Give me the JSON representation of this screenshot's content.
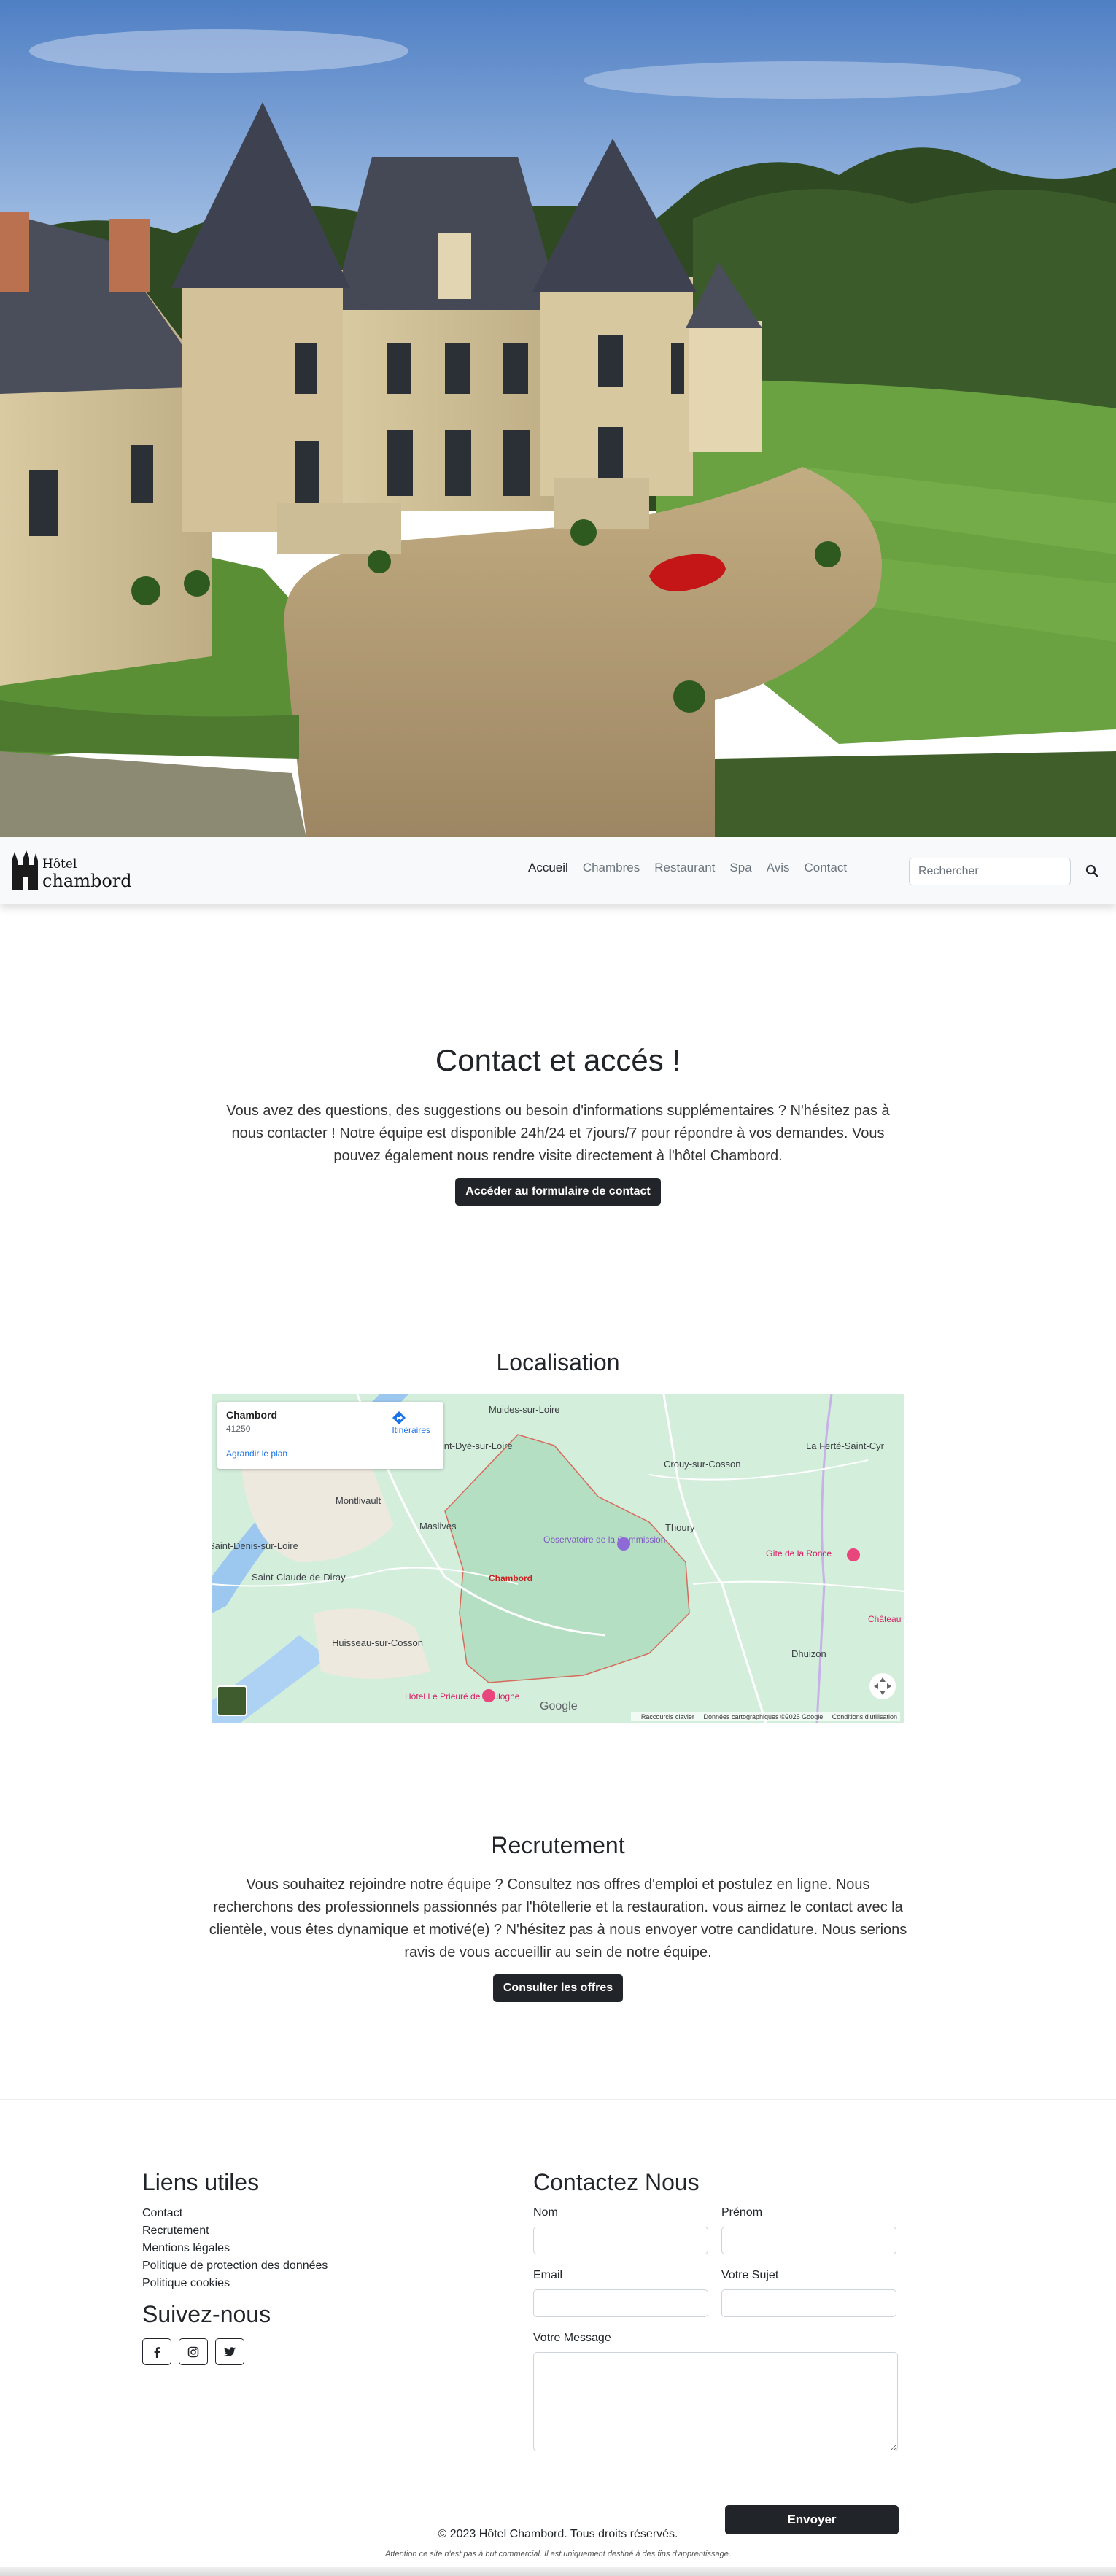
{
  "hero": {
    "image": "chateau-hotel-aerial-photo"
  },
  "navbar": {
    "brand_small": "Hôtel",
    "brand_big": "chambord",
    "links": [
      "Accueil",
      "Chambres",
      "Restaurant",
      "Spa",
      "Avis",
      "Contact"
    ],
    "active": "Accueil",
    "search_placeholder": "Rechercher",
    "search_icon": "search-icon"
  },
  "contact": {
    "title": "Contact et accés !",
    "text": "Vous avez des questions, des suggestions ou besoin d'informations supplémentaires ? N'hésitez pas à nous contacter ! Notre équipe est disponible 24h/24 et 7jours/7 pour répondre à vos demandes. Vous pouvez également nous rendre visite directement à l'hôtel Chambord.",
    "button": "Accéder au formulaire de contact"
  },
  "localisation": {
    "title": "Localisation",
    "map": {
      "place_name": "Chambord",
      "place_zip": "41250",
      "directions": "Itinéraires",
      "enlarge": "Agrandir le plan",
      "labels": [
        "Muides-sur-Loire",
        "Saint-Dyé-sur-Loire",
        "Montlivault",
        "Maslives",
        "Saint-Claude-de-Diray",
        "Huisseau-sur-Cosson",
        "Chambord",
        "Observatoire de la Commission",
        "Crouy-sur-Cosson",
        "Thoury",
        "La Ferté-Saint-Cyr",
        "Gîte de la Ronce",
        "Dhuizon",
        "Hôtel Le Prieuré de Boulogne",
        "Saint-Denis-sur-Loire",
        "Château de Chambord"
      ],
      "attribution_google": "Google",
      "footer": [
        "Raccourcis clavier",
        "Données cartographiques ©2025 Google",
        "Conditions d'utilisation"
      ]
    }
  },
  "recrutement": {
    "title": "Recrutement",
    "text": "Vous souhaitez rejoindre notre équipe ? Consultez nos offres d'emploi et postulez en ligne. Nous recherchons des professionnels passionnés par l'hôtellerie et la restauration. vous aimez le contact avec la clientèle, vous êtes dynamique et motivé(e) ? N'hésitez pas à nous envoyer votre candidature. Nous serions ravis de vous accueillir au sein de notre équipe.",
    "button": "Consulter les offres"
  },
  "footer": {
    "links_title": "Liens utiles",
    "links": [
      "Contact",
      "Recrutement",
      "Mentions légales",
      "Politique de protection des données",
      "Politique cookies"
    ],
    "social_title": "Suivez-nous",
    "social_icons": [
      "facebook-icon",
      "instagram-icon",
      "twitter-icon"
    ],
    "form_title": "Contactez Nous",
    "form": {
      "nom": "Nom",
      "prenom": "Prénom",
      "email": "Email",
      "sujet": "Votre Sujet",
      "message": "Votre Message",
      "submit": "Envoyer"
    },
    "copyright": "© 2023 Hôtel Chambord. Tous droits réservés.",
    "disclaimer": "Attention ce site n'est pas à but commercial. Il est uniquement destiné à des fins d'apprentissage."
  }
}
